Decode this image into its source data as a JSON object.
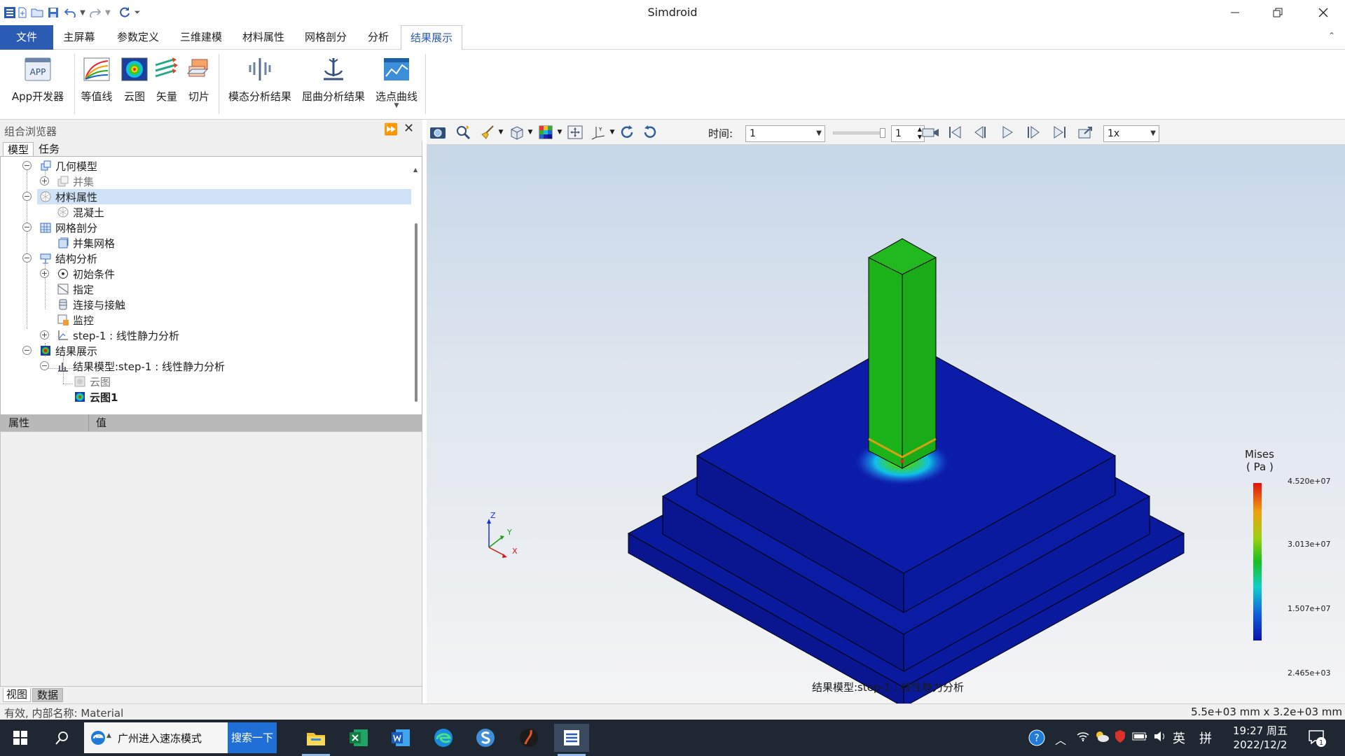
{
  "app": {
    "title": "Simdroid"
  },
  "menu": {
    "tabs": [
      {
        "label": "文件"
      },
      {
        "label": "主屏幕"
      },
      {
        "label": "参数定义"
      },
      {
        "label": "三维建模"
      },
      {
        "label": "材料属性"
      },
      {
        "label": "网格剖分"
      },
      {
        "label": "分析"
      },
      {
        "label": "结果展示"
      }
    ],
    "active": "结果展示"
  },
  "ribbon": {
    "buttons": [
      {
        "label": "App开发器",
        "icon": "app-developer-icon",
        "badge": "APP"
      },
      {
        "label": "等值线",
        "icon": "contour-lines-icon"
      },
      {
        "label": "云图",
        "icon": "cloud-map-icon"
      },
      {
        "label": "矢量",
        "icon": "vector-icon"
      },
      {
        "label": "切片",
        "icon": "slice-icon"
      },
      {
        "label": "模态分析结果",
        "icon": "modal-result-icon"
      },
      {
        "label": "屈曲分析结果",
        "icon": "buckling-result-icon"
      },
      {
        "label": "选点曲线",
        "icon": "point-curve-icon"
      }
    ]
  },
  "browser": {
    "title": "组合浏览器",
    "tabs": [
      "模型",
      "任务"
    ],
    "tree": [
      {
        "label": "几何模型",
        "icon": "geometry-icon"
      },
      {
        "label": "并集",
        "icon": "union-icon"
      },
      {
        "label": "材料属性",
        "icon": "material-icon"
      },
      {
        "label": "混凝土",
        "icon": "concrete-icon"
      },
      {
        "label": "网格剖分",
        "icon": "mesh-icon"
      },
      {
        "label": "并集网格",
        "icon": "union-mesh-icon"
      },
      {
        "label": "结构分析",
        "icon": "structure-analysis-icon"
      },
      {
        "label": "初始条件",
        "icon": "initial-condition-icon"
      },
      {
        "label": "指定",
        "icon": "assign-icon"
      },
      {
        "label": "连接与接触",
        "icon": "contact-icon"
      },
      {
        "label": "监控",
        "icon": "monitor-icon"
      },
      {
        "label": "step-1 : 线性静力分析",
        "icon": "step-icon"
      },
      {
        "label": "结果展示",
        "icon": "result-icon"
      },
      {
        "label": "结果模型:step-1 : 线性静力分析",
        "icon": "result-model-icon"
      },
      {
        "label": "云图",
        "icon": "cloud-map-icon"
      },
      {
        "label": "云图1",
        "icon": "cloud-map-icon"
      }
    ]
  },
  "properties": {
    "col_property": "属性",
    "col_value": "值"
  },
  "bottom_tabs": [
    "视图",
    "数据"
  ],
  "viewport": {
    "time_label": "时间:",
    "time_value": "1",
    "frame_value": "1",
    "speed_value": "1x",
    "caption": "结果模型:step-1 : 线性静力分析",
    "axes": {
      "x": "X",
      "y": "Y",
      "z": "Z"
    },
    "legend": {
      "title": "Mises",
      "unit": "( Pa )",
      "values": [
        "4.520e+07",
        "3.013e+07",
        "1.507e+07",
        "2.465e+03"
      ]
    }
  },
  "status": {
    "left": "有效, 内部名称: Material",
    "right": "5.5e+03 mm x 3.2e+03 mm"
  },
  "taskbar": {
    "search_text": "广州进入速冻模式",
    "search_button": "搜索一下",
    "ime1": "英",
    "ime2": "拼",
    "time": "19:27 周五",
    "date": "2022/12/2",
    "notif_count": "1"
  }
}
